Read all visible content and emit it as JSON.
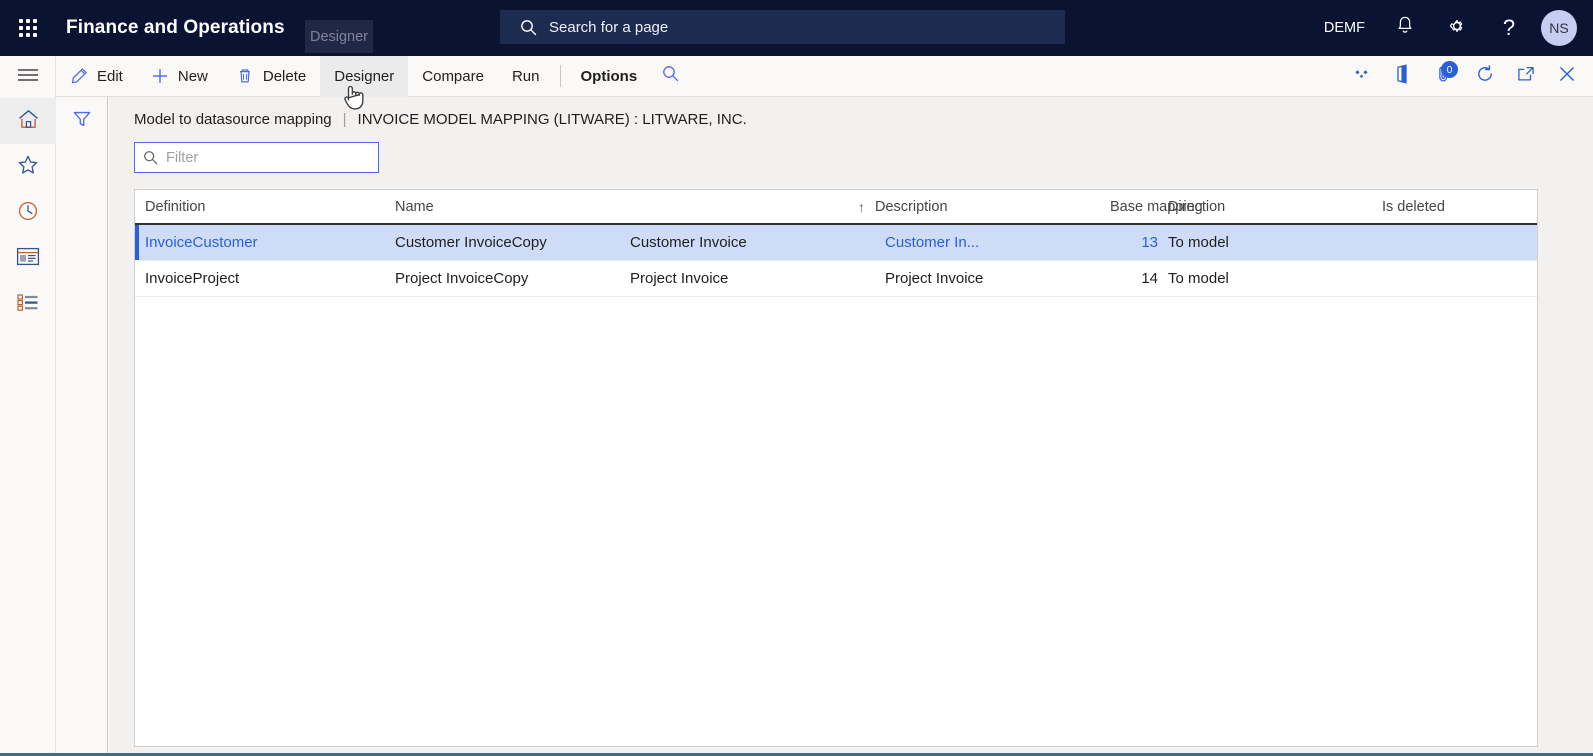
{
  "header": {
    "waffle_icon": "waffle-grid-icon",
    "app_title": "Finance and Operations",
    "tooltip_label": "Designer",
    "search": {
      "placeholder": "Search for a page",
      "icon": "search-icon"
    },
    "company": "DEMF",
    "notification_icon": "bell-icon",
    "settings_icon": "gear-icon",
    "help_icon": "question-icon",
    "avatar_initials": "NS"
  },
  "toolbar": {
    "edit_label": "Edit",
    "new_label": "New",
    "delete_label": "Delete",
    "designer_label": "Designer",
    "compare_label": "Compare",
    "run_label": "Run",
    "options_label": "Options",
    "search_icon": "search-icon",
    "right_icons": [
      {
        "name": "relationships-icon"
      },
      {
        "name": "office-apps-icon"
      },
      {
        "name": "attachments-icon",
        "badge": "0"
      },
      {
        "name": "refresh-icon"
      },
      {
        "name": "popout-icon"
      },
      {
        "name": "close-icon"
      }
    ]
  },
  "navrail": {
    "items": [
      {
        "name": "hamburger-menu",
        "icon": "hamburger-icon"
      },
      {
        "name": "home",
        "icon": "home-icon"
      },
      {
        "name": "favorites",
        "icon": "star-icon"
      },
      {
        "name": "recent",
        "icon": "clock-icon"
      },
      {
        "name": "workspaces",
        "icon": "workspace-icon"
      },
      {
        "name": "modules",
        "icon": "modules-list-icon"
      }
    ]
  },
  "filter_panel": {
    "funnel_icon": "filter-funnel-icon"
  },
  "page": {
    "caption_primary": "Model to datasource mapping",
    "caption_separator": "|",
    "caption_secondary": "INVOICE MODEL MAPPING (LITWARE) : LITWARE, INC.",
    "filter": {
      "placeholder": "Filter",
      "icon": "search-icon",
      "value": ""
    }
  },
  "grid": {
    "columns": [
      {
        "key": "definition",
        "label": "Definition"
      },
      {
        "key": "name",
        "label": "Name",
        "sorted": "asc",
        "sort_arrow": "↑"
      },
      {
        "key": "description",
        "label": "Description"
      },
      {
        "key": "base_mapping",
        "label": "Base mapping"
      },
      {
        "key": "direction_num",
        "label": ""
      },
      {
        "key": "direction",
        "label": "Direction"
      },
      {
        "key": "is_deleted",
        "label": "Is deleted"
      }
    ],
    "rows": [
      {
        "definition": "InvoiceCustomer",
        "name": "Customer InvoiceCopy",
        "description": "Customer Invoice",
        "base_mapping": "Customer In...",
        "direction_num": "13",
        "direction": "To model",
        "is_deleted": "",
        "selected": true
      },
      {
        "definition": "InvoiceProject",
        "name": "Project InvoiceCopy",
        "description": "Project Invoice",
        "base_mapping": "Project Invoice",
        "direction_num": "14",
        "direction": "To model",
        "is_deleted": "",
        "selected": false
      }
    ]
  },
  "colors": {
    "header_bg": "#0b1333",
    "accent_blue": "#2a5fd7",
    "selected_row": "#cfdcf7",
    "status_bar": "#3e6e81"
  }
}
